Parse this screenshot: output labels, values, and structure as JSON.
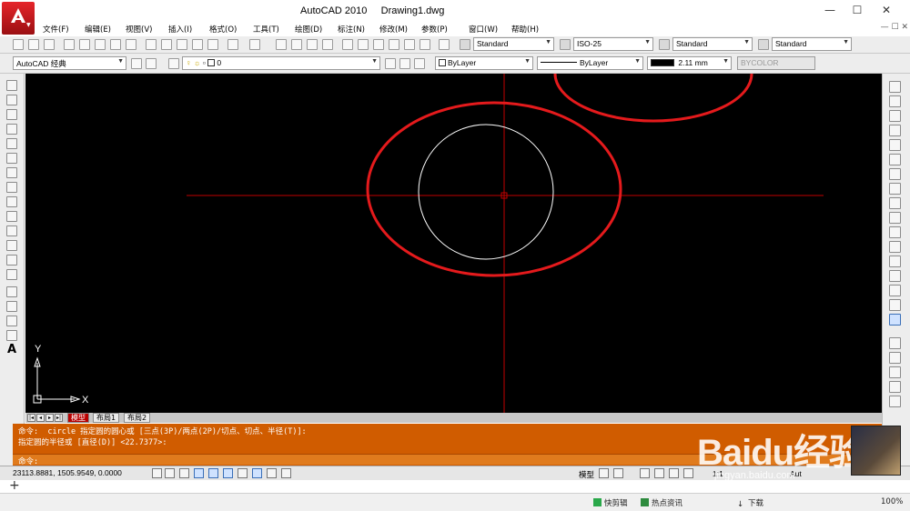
{
  "window": {
    "title": "AutoCAD 2010     Drawing1.dwg",
    "controls": [
      "—",
      "☐",
      "✕"
    ],
    "app_logo": "autocad-a-logo"
  },
  "menu": {
    "items": [
      "文件(F)",
      "编辑(E)",
      "视图(V)",
      "插入(I)",
      "格式(O)",
      "工具(T)",
      "绘图(D)",
      "标注(N)",
      "修改(M)",
      "参数(P)",
      "窗口(W)",
      "帮助(H)"
    ],
    "doc_controls": "— ☐ ✕"
  },
  "toolbar_styles": {
    "text_style": "Standard",
    "dim_style": "ISO-25",
    "table_style": "Standard",
    "mleader_style": "Standard"
  },
  "toolbar_properties": {
    "workspace": "AutoCAD 经典",
    "layer": "0",
    "color": "ByLayer",
    "linetype": "ByLayer",
    "lineweight": "2.11 mm",
    "plot_style": "BYCOLOR"
  },
  "canvas": {
    "ucs_x_label": "X",
    "ucs_y_label": "Y",
    "background": "#000000",
    "crosshair_color": "#c00000",
    "circle_color": "#ffffff",
    "annotation_color": "#e41a1c"
  },
  "tabs": {
    "nav": [
      "|◂",
      "◂",
      "▸",
      "▸|"
    ],
    "items": [
      "模型",
      "布局1",
      "布局2"
    ],
    "active": "模型"
  },
  "command": {
    "line1": "命令:  circle 指定圆的圆心或 [三点(3P)/两点(2P)/切点、切点、半径(T)]:",
    "line2": "指定圆的半径或 [直径(D)] <22.7377>:",
    "prompt": "命令:"
  },
  "status": {
    "coordinates": "23113.8881, 1505.9549, 0.0000",
    "model_label": "模型",
    "scale": "1:1",
    "annotation": "Aut"
  },
  "taskbar": {
    "items": [
      "快剪辑",
      "热点资讯",
      "下载"
    ],
    "zoom": "100%"
  },
  "watermark": {
    "text": "Baidu经验",
    "url": "jingyan.baidu.com"
  }
}
